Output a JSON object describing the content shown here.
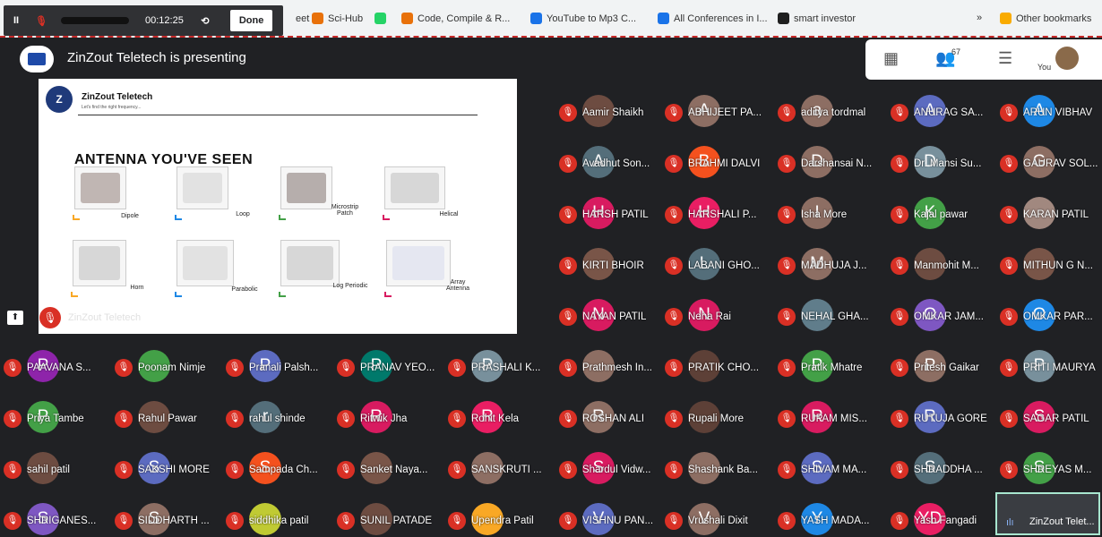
{
  "browser": {
    "bookmarks": [
      {
        "label": "eet",
        "icon": "meet-icon",
        "color": "#f1f3f4"
      },
      {
        "label": "Sci-Hub",
        "icon": "scihub-icon",
        "color": "#e8710a"
      },
      {
        "label": "",
        "icon": "whatsapp-icon",
        "color": "#25d366"
      },
      {
        "label": "Code, Compile & R...",
        "icon": "code-icon",
        "color": "#e8710a"
      },
      {
        "label": "YouTube to Mp3 C...",
        "icon": "youtube-mp3-icon",
        "color": "#1a73e8"
      },
      {
        "label": "All Conferences in I...",
        "icon": "conference-icon",
        "color": "#1a73e8"
      },
      {
        "label": "smart investor",
        "icon": "si-icon",
        "color": "#1f1f1f"
      }
    ],
    "chevron": "»",
    "other_bookmarks": "Other bookmarks"
  },
  "recorder": {
    "pause": "II",
    "time": "00:12:25",
    "undo": "⟲",
    "done": "Done"
  },
  "meeting": {
    "presenting": "ZinZout Teletech is presenting",
    "you_label": "You",
    "participant_count_badge": "67"
  },
  "slide": {
    "logo_letter": "Z",
    "brand": "ZinZout Teletech",
    "tagline": "Let's find the right frequency...",
    "title": "ANTENNA YOU'VE SEEN",
    "antennas": [
      "Dipole",
      "Loop",
      "Microstrip Patch",
      "Helical",
      "Horn",
      "Parabolic",
      "Log Periodic",
      "Array Antenna"
    ]
  },
  "presenter_strip": {
    "name": "ZinZout Teletech",
    "icon": "present-icon"
  },
  "participants": [
    {
      "name": "Aamir Shaikh",
      "letter": "",
      "color": "#6d4c41"
    },
    {
      "name": "ABHIJEET PA...",
      "letter": "A",
      "color": "#8d6e63"
    },
    {
      "name": "aditya tordmal",
      "letter": "a",
      "color": "#8d6e63"
    },
    {
      "name": "ANURAG SA...",
      "letter": "A",
      "color": "#5c6bc0"
    },
    {
      "name": "ARUN VIBHAV",
      "letter": "A",
      "color": "#1e88e5"
    },
    {
      "name": "Avadhut Son...",
      "letter": "A",
      "color": "#546e7a"
    },
    {
      "name": "BRAHMI DALVI",
      "letter": "B",
      "color": "#f4511e"
    },
    {
      "name": "Darshansai N...",
      "letter": "D",
      "color": "#8d6e63"
    },
    {
      "name": "Dr. Mansi Su...",
      "letter": "D",
      "color": "#78909c"
    },
    {
      "name": "GAURAV SOL...",
      "letter": "G",
      "color": "#8d6e63"
    },
    {
      "name": "HARSH PATIL",
      "letter": "H",
      "color": "#d81b60"
    },
    {
      "name": "HARSHALI P...",
      "letter": "H",
      "color": "#e91e63"
    },
    {
      "name": "Isha More",
      "letter": "I",
      "color": "#8d6e63"
    },
    {
      "name": "Kajal pawar",
      "letter": "K",
      "color": "#43a047"
    },
    {
      "name": "KARAN PATIL",
      "letter": "",
      "color": "#a1887f"
    },
    {
      "name": "KIRTI BHOIR",
      "letter": "",
      "color": "#795548"
    },
    {
      "name": "LABANI GHO...",
      "letter": "L",
      "color": "#546e7a"
    },
    {
      "name": "MADHUJA J...",
      "letter": "M",
      "color": "#8d6e63"
    },
    {
      "name": "Manmohit M...",
      "letter": "",
      "color": "#6d4c41"
    },
    {
      "name": "MITHUN G N...",
      "letter": "",
      "color": "#795548"
    },
    {
      "name": "NAYAN PATIL",
      "letter": "N",
      "color": "#d81b60"
    },
    {
      "name": "Neha Rai",
      "letter": "N",
      "color": "#d81b60"
    },
    {
      "name": "NEHAL GHA...",
      "letter": "",
      "color": "#607d8b"
    },
    {
      "name": "OMKAR JAM...",
      "letter": "O",
      "color": "#7e57c2"
    },
    {
      "name": "OMKAR PAR...",
      "letter": "O",
      "color": "#1e88e5"
    },
    {
      "name": "PAAVANA S...",
      "letter": "P",
      "color": "#8e24aa"
    },
    {
      "name": "Poonam Nimje",
      "letter": "",
      "color": "#43a047"
    },
    {
      "name": "Pranali Palsh...",
      "letter": "P",
      "color": "#5c6bc0"
    },
    {
      "name": "PRANAV YEO...",
      "letter": "P",
      "color": "#00796b"
    },
    {
      "name": "PRASHALI K...",
      "letter": "P",
      "color": "#78909c"
    },
    {
      "name": "Prathmesh In...",
      "letter": "",
      "color": "#8d6e63"
    },
    {
      "name": "PRATIK CHO...",
      "letter": "",
      "color": "#5d4037"
    },
    {
      "name": "Pratik Mhatre",
      "letter": "P",
      "color": "#43a047"
    },
    {
      "name": "Pritesh Gaikar",
      "letter": "P",
      "color": "#8d6e63"
    },
    {
      "name": "PRITI MAURYA",
      "letter": "P",
      "color": "#78909c"
    },
    {
      "name": "Priya Tambe",
      "letter": "P",
      "color": "#43a047"
    },
    {
      "name": "Rahul Pawar",
      "letter": "",
      "color": "#6d4c41"
    },
    {
      "name": "rahul shinde",
      "letter": "r",
      "color": "#546e7a"
    },
    {
      "name": "Ritwik Jha",
      "letter": "R",
      "color": "#d81b60"
    },
    {
      "name": "Rohit Kela",
      "letter": "R",
      "color": "#e91e63"
    },
    {
      "name": "ROSHAN ALI",
      "letter": "R",
      "color": "#8d6e63"
    },
    {
      "name": "Rupali More",
      "letter": "",
      "color": "#5d4037"
    },
    {
      "name": "RUPAM MIS...",
      "letter": "R",
      "color": "#d81b60"
    },
    {
      "name": "RUTUJA GORE",
      "letter": "R",
      "color": "#5c6bc0"
    },
    {
      "name": "SAGAR PATIL",
      "letter": "S",
      "color": "#d81b60"
    },
    {
      "name": "sahil patil",
      "letter": "",
      "color": "#6d4c41"
    },
    {
      "name": "SAKSHI MORE",
      "letter": "S",
      "color": "#5c6bc0"
    },
    {
      "name": "Sampada Ch...",
      "letter": "S",
      "color": "#f4511e"
    },
    {
      "name": "Sanket Naya...",
      "letter": "",
      "color": "#795548"
    },
    {
      "name": "SANSKRUTI ...",
      "letter": "",
      "color": "#8d6e63"
    },
    {
      "name": "Shardul Vidw...",
      "letter": "S",
      "color": "#d81b60"
    },
    {
      "name": "Shashank Ba...",
      "letter": "",
      "color": "#8d6e63"
    },
    {
      "name": "SHIVAM MA...",
      "letter": "S",
      "color": "#5c6bc0"
    },
    {
      "name": "SHRADDHA ...",
      "letter": "S",
      "color": "#546e7a"
    },
    {
      "name": "SHREYAS M...",
      "letter": "S",
      "color": "#43a047"
    },
    {
      "name": "SHRIGANES...",
      "letter": "S",
      "color": "#7e57c2"
    },
    {
      "name": "SIDDHARTH ...",
      "letter": "S",
      "color": "#8d6e63"
    },
    {
      "name": "siddhika patil",
      "letter": "",
      "color": "#c0ca33"
    },
    {
      "name": "SUNIL PATADE",
      "letter": "",
      "color": "#6d4c41"
    },
    {
      "name": "Upendra Patil",
      "letter": "",
      "color": "#f9a825"
    },
    {
      "name": "VISHNU PAN...",
      "letter": "V",
      "color": "#5c6bc0"
    },
    {
      "name": "Vrushali Dixit",
      "letter": "V",
      "color": "#8d6e63"
    },
    {
      "name": "YASH MADA...",
      "letter": "Y",
      "color": "#1e88e5"
    },
    {
      "name": "Yash Fangadi",
      "letter": "YD",
      "color": "#e91e63"
    }
  ],
  "self_tile": {
    "name": "ZinZout Telet..."
  }
}
